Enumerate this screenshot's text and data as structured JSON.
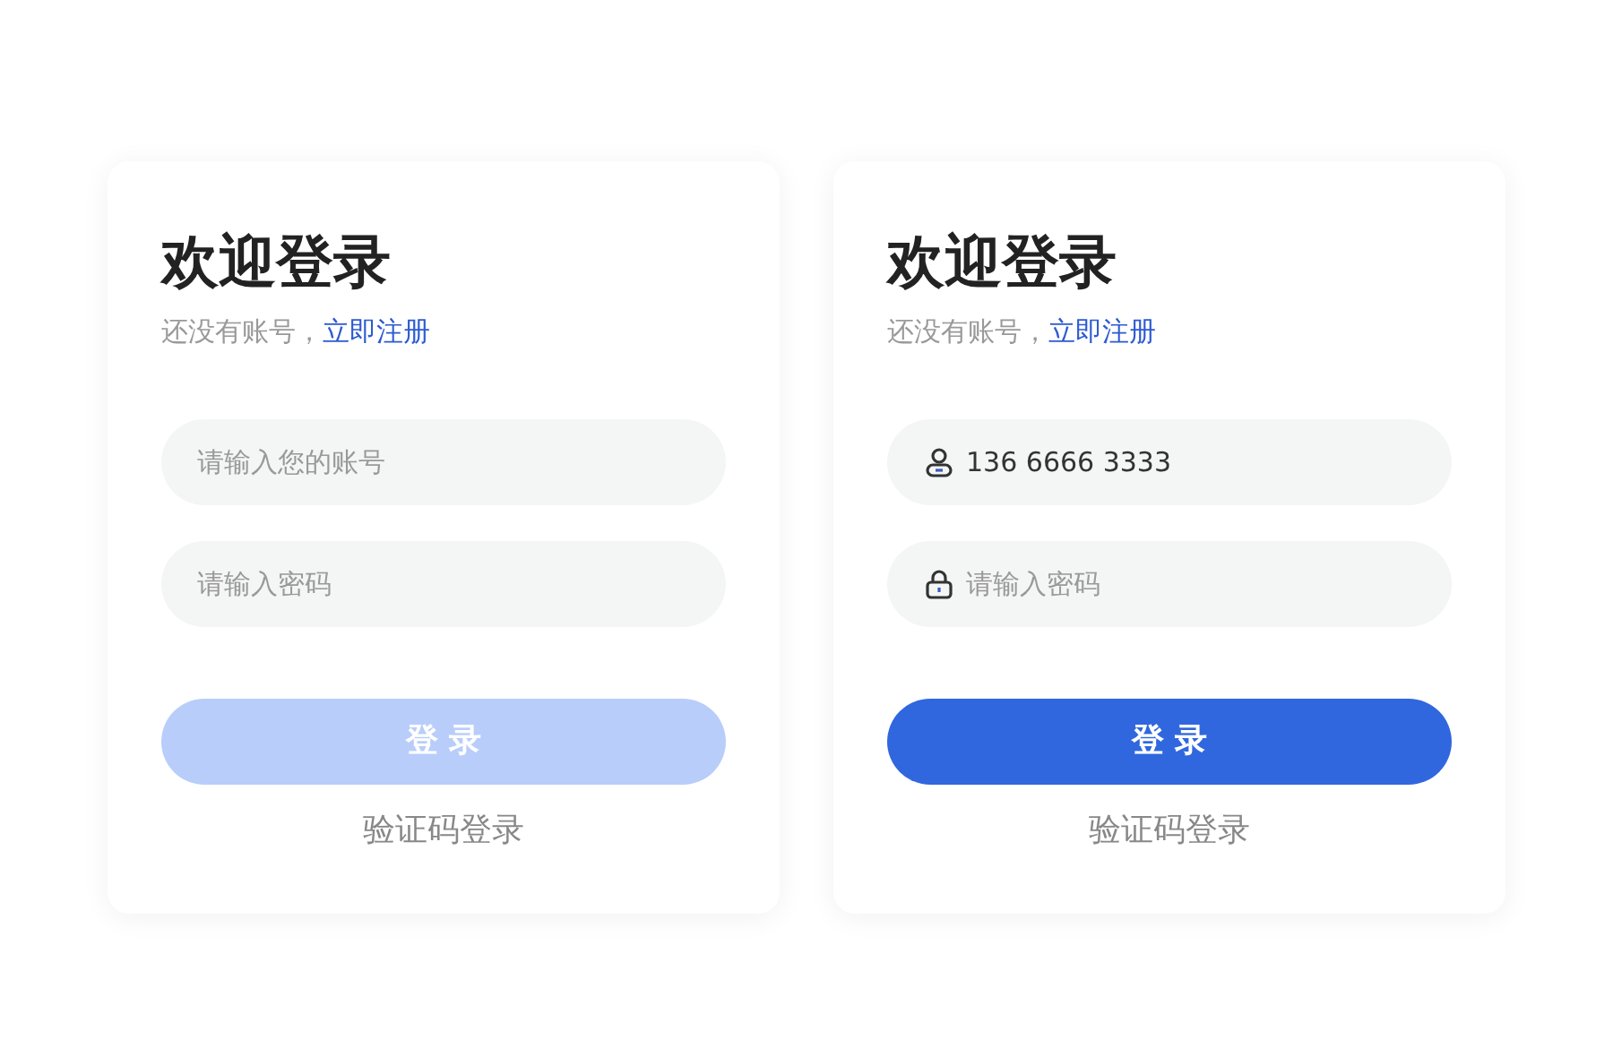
{
  "cards": [
    {
      "kind": "plain",
      "title": "欢迎登录",
      "subtitle": "还没有账号，",
      "register_link": "立即注册",
      "account": {
        "placeholder": "请输入您的账号"
      },
      "password": {
        "placeholder": "请输入密码"
      },
      "login_button": {
        "label": "登 录",
        "disabled": true
      },
      "alt_link": "验证码登录"
    },
    {
      "kind": "with-icons",
      "title": "欢迎登录",
      "subtitle": "还没有账号，",
      "register_link": "立即注册",
      "account": {
        "value": "136 6666 3333"
      },
      "password": {
        "placeholder": "请输入密码"
      },
      "login_button": {
        "label": "登 录",
        "disabled": false
      },
      "alt_link": "验证码登录"
    }
  ]
}
